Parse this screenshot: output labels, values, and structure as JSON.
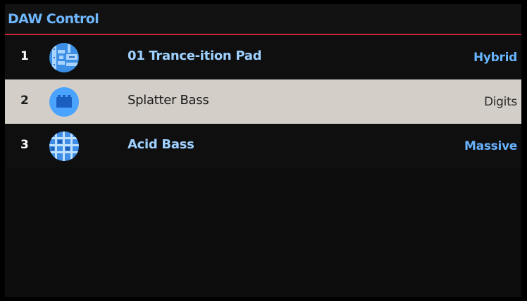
{
  "header": {
    "title": "DAW Control"
  },
  "tracks": [
    {
      "number": "1",
      "name": "01 Trance-ition Pad",
      "type": "Hybrid",
      "icon": "circuit-board-icon",
      "selected": false
    },
    {
      "number": "2",
      "name": "Splatter Bass",
      "type": "Digits",
      "icon": "block-icon",
      "selected": true
    },
    {
      "number": "3",
      "name": "Acid Bass",
      "type": "Massive",
      "icon": "grid-globe-icon",
      "selected": false
    }
  ],
  "colors": {
    "accent": "#69b4ff",
    "header_divider": "#c7263a",
    "selected_row": "#d3cfc8",
    "background": "#0d0d0d"
  }
}
